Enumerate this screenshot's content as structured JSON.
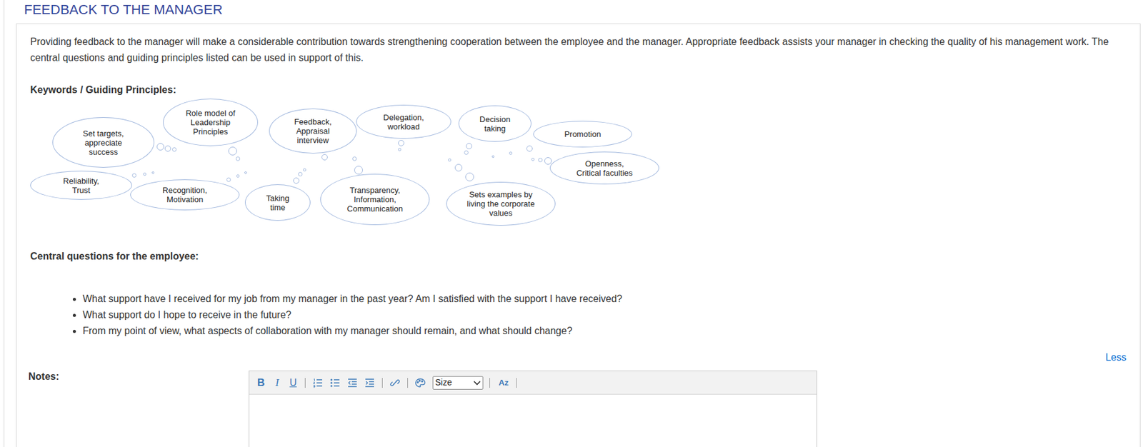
{
  "section": {
    "title": "FEEDBACK TO THE MANAGER",
    "intro": "Providing feedback to the manager will make a considerable contribution towards strengthening cooperation between the employee and the manager. Appropriate feedback assists your manager in checking the quality of his management work. The central questions and guiding principles listed can be used in support of this.",
    "keywords_heading": "Keywords / Guiding Principles:",
    "keywords": [
      {
        "lines": [
          "Set targets,",
          "appreciate",
          "success"
        ]
      },
      {
        "lines": [
          "Role model of",
          "Leadership",
          "Principles"
        ]
      },
      {
        "lines": [
          "Feedback,",
          "Appraisal",
          "interview"
        ]
      },
      {
        "lines": [
          "Delegation,",
          "workload"
        ]
      },
      {
        "lines": [
          "Decision",
          "taking"
        ]
      },
      {
        "lines": [
          "Promotion"
        ]
      },
      {
        "lines": [
          "Openness,",
          "Critical faculties"
        ]
      },
      {
        "lines": [
          "Reliability,",
          "Trust"
        ]
      },
      {
        "lines": [
          "Recognition,",
          "Motivation"
        ]
      },
      {
        "lines": [
          "Taking",
          "time"
        ]
      },
      {
        "lines": [
          "Transparency,",
          "Information,",
          "Communication"
        ]
      },
      {
        "lines": [
          "Sets examples by",
          "living the corporate",
          "values"
        ]
      }
    ],
    "questions_heading": "Central questions for the employee:",
    "questions": [
      "What support have I received for my job from my manager in the past year? Am I satisfied with the support I have received?",
      "What support do I hope to receive in the future?",
      "From my point of view, what aspects of collaboration with my manager should remain, and what should change?"
    ],
    "less_link": "Less",
    "notes_label": "Notes:",
    "toolbar": {
      "bold": "B",
      "italic": "I",
      "underline": "U",
      "size": "Size",
      "clear_format": "Az"
    }
  }
}
